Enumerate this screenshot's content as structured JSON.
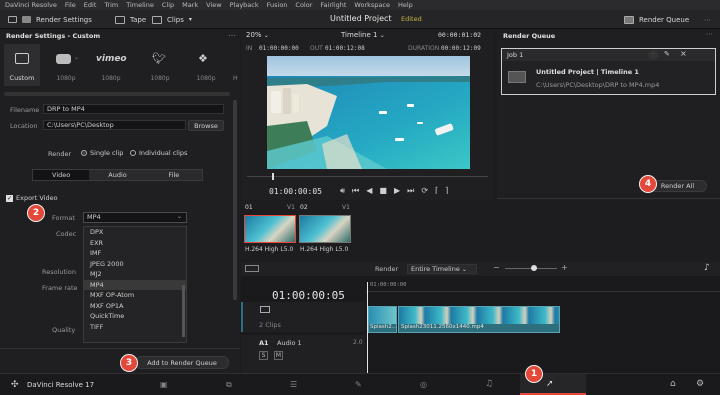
{
  "menu": [
    "DaVinci Resolve",
    "File",
    "Edit",
    "Trim",
    "Timeline",
    "Clip",
    "Mark",
    "View",
    "Playback",
    "Fusion",
    "Color",
    "Fairlight",
    "Workspace",
    "Help"
  ],
  "toolbar": {
    "render_settings": "Render Settings",
    "tape": "Tape",
    "clips": "Clips",
    "project_title": "Untitled Project",
    "edited": "Edited",
    "render_queue": "Render Queue"
  },
  "render_settings": {
    "title": "Render Settings - Custom",
    "presets": [
      {
        "label": "Custom",
        "sub": ""
      },
      {
        "label": "",
        "sub": "1080p",
        "brand": "YouTube"
      },
      {
        "label": "vimeo",
        "sub": "1080p"
      },
      {
        "label": "",
        "sub": "1080p",
        "brand": "Twitter"
      },
      {
        "label": "",
        "sub": "1080p",
        "brand": "Dropbox"
      },
      {
        "label": "",
        "sub": "H"
      }
    ],
    "filename_label": "Filename",
    "filename_value": "DRP to MP4",
    "location_label": "Location",
    "location_value": "C:\\Users\\PC\\Desktop",
    "browse": "Browse",
    "render_label": "Render",
    "single_clip": "Single clip",
    "individual_clips": "Individual clips",
    "tabs": [
      "Video",
      "Audio",
      "File"
    ],
    "export_video": "Export Video",
    "format_label": "Format",
    "format_value": "MP4",
    "codec_label": "Codec",
    "resolution_label": "Resolution",
    "frame_rate_label": "Frame rate",
    "quality_label": "Quality",
    "format_options": [
      "DPX",
      "EXR",
      "IMF",
      "JPEG 2000",
      "MJ2",
      "MP4",
      "MXF OP-Atom",
      "MXF OP1A",
      "QuickTime",
      "TIFF"
    ],
    "selected_format": "MP4",
    "add_to_queue": "Add to Render Queue"
  },
  "viewer": {
    "zoom": "20%",
    "timeline_name": "Timeline 1",
    "timecode_top": "00:00:01:02",
    "in_label": "IN",
    "in_value": "01:00:00:00",
    "out_label": "OUT",
    "out_value": "01:00:12:08",
    "duration_label": "DURATION",
    "duration_value": "00:00:12:09",
    "current_tc": "01:00:00:05"
  },
  "thumbs": [
    {
      "num": "01",
      "track": "V1",
      "codec": "H.264 High L5.0"
    },
    {
      "num": "02",
      "track": "V1",
      "codec": "H.264 High L5.0"
    }
  ],
  "timeline": {
    "render_label": "Render",
    "render_scope": "Entire Timeline",
    "timecode": "01:00:00:05",
    "ruler_start": "01:00:00:00",
    "clips_label": "2 Clips",
    "clip1": "Splash2...",
    "clip2": "Splash23011.2560x1440.mp4",
    "audio_track": "A1",
    "audio_name": "Audio 1",
    "audio_level": "2.0",
    "s": "S",
    "m": "M"
  },
  "render_queue": {
    "title": "Render Queue",
    "job_label": "Job 1",
    "job_title": "Untitled Project | Timeline 1",
    "job_path": "C:\\Users\\PC\\Desktop\\DRP to MP4.mp4",
    "render_all": "Render All"
  },
  "footer": {
    "app_name": "DaVinci Resolve 17"
  },
  "badges": [
    "1",
    "2",
    "3",
    "4"
  ],
  "accent": "#e2493b"
}
